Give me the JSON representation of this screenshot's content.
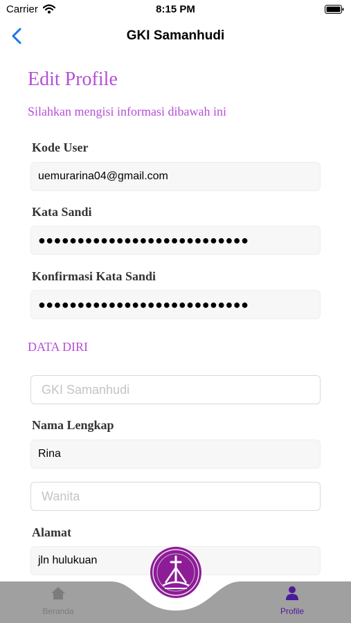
{
  "status": {
    "carrier": "Carrier",
    "time": "8:15 PM"
  },
  "nav": {
    "title": "GKI Samanhudi"
  },
  "form": {
    "heading": "Edit Profile",
    "subheading": "Silahkan mengisi informasi dibawah ini",
    "kode_user_label": "Kode User",
    "kode_user_value": "uemurarina04@gmail.com",
    "kata_sandi_label": "Kata Sandi",
    "kata_sandi_value": "●●●●●●●●●●●●●●●●●●●●●●●●●●●",
    "konfirmasi_label": "Konfirmasi Kata Sandi",
    "konfirmasi_value": "●●●●●●●●●●●●●●●●●●●●●●●●●●●",
    "data_diri_title": "DATA DIRI",
    "gereja_placeholder": "GKI Samanhudi",
    "nama_label": "Nama Lengkap",
    "nama_value": "Rina",
    "gender_placeholder": "Wanita",
    "alamat_label": "Alamat",
    "alamat_value": "jln hulukuan"
  },
  "tabs": [
    {
      "label": "Beranda",
      "icon": "home-icon",
      "active": false
    },
    {
      "label": "Profile",
      "icon": "person-icon",
      "active": true
    }
  ],
  "colors": {
    "accent": "#b44fd6",
    "tab_active": "#4b1a99",
    "fab": "#8c1d96",
    "tab_bar": "#a0a0a0"
  }
}
